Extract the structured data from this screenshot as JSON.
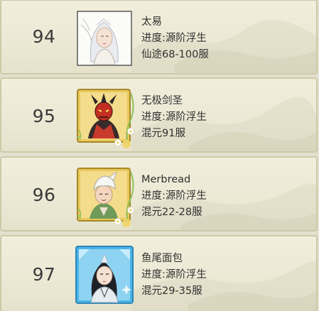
{
  "players": [
    {
      "rank": "94",
      "name": "太易",
      "progress": "进度:源阶浮生",
      "server": "仙途68-100服",
      "frame": "plain",
      "avatar": "white-haired-female-avatar"
    },
    {
      "rank": "95",
      "name": "无极剑圣",
      "progress": "进度:源阶浮生",
      "server": "混元91服",
      "frame": "gold",
      "avatar": "demon-mask-avatar"
    },
    {
      "rank": "96",
      "name": "Merbread",
      "progress": "进度:源阶浮生",
      "server": "混元22-28服",
      "frame": "gold",
      "avatar": "white-cap-boy-avatar"
    },
    {
      "rank": "97",
      "name": "鱼尾面包",
      "progress": "进度:源阶浮生",
      "server": "混元29-35服",
      "frame": "blue",
      "avatar": "black-haired-male-avatar"
    }
  ],
  "colors": {
    "row_bg": "#eeebd8",
    "row_border": "#cfc9a8",
    "text": "#303030",
    "gold_frame": "#e8c857",
    "blue_frame": "#4fb6e3"
  }
}
